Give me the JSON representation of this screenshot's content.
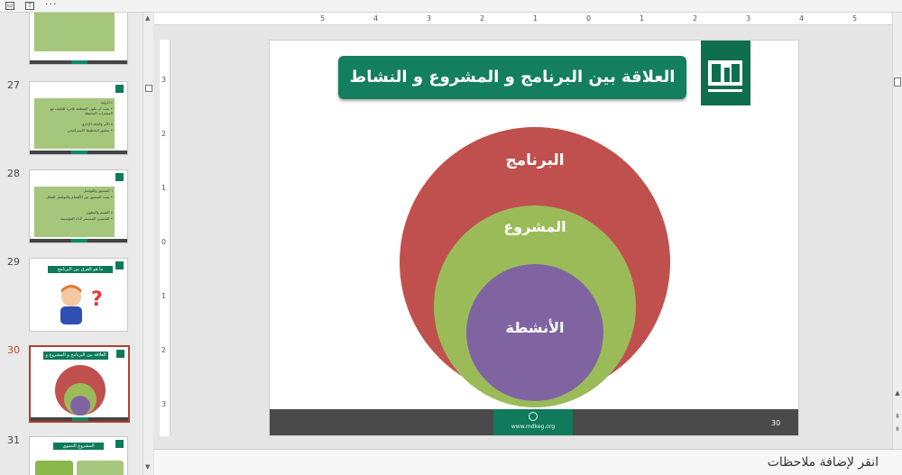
{
  "slides": [
    {
      "number": "27",
      "lines": [
        "٤ الرؤية",
        "• يجب أن تكون المنظمة قادرة للتكيف مع المتغيرات المحيطة",
        "٥ الأثر والعائد الإداري",
        "• تحقيق التخطيط الاستراتيجي"
      ]
    },
    {
      "number": "28",
      "lines": [
        "٦ التنسيق والتواصل",
        "• يجب التنسيق بين الأقسام والتواصل الفعال",
        "٧ التقييم والتطوير",
        "• التحسين المستمر لأداء المؤسسة"
      ]
    },
    {
      "number": "29",
      "title": "ما هو الفرق بين البرنامج والمشروع ؟"
    },
    {
      "number": "30",
      "title": "العلاقة بين البرنامج و المشروع و النشاط",
      "active": true
    },
    {
      "number": "31",
      "title": "المشروع التنموي"
    }
  ],
  "ruler": {
    "horizontal": [
      "5",
      "4",
      "3",
      "2",
      "1",
      "0",
      "1",
      "2",
      "3",
      "4",
      "5"
    ],
    "vertical": [
      "3",
      "2",
      "1",
      "0",
      "1",
      "2",
      "3"
    ]
  },
  "slide": {
    "title": "العلاقة بين البرنامج و المشروع و النشاط",
    "circles": {
      "outer": {
        "label": "البرنامج",
        "color": "#c0504d"
      },
      "middle": {
        "label": "المشروع",
        "color": "#9bbb59"
      },
      "inner": {
        "label": "الأنشطة",
        "color": "#8064a2"
      }
    },
    "footer_url": "www.mdkeg.org",
    "slide_number": "30"
  },
  "notes_placeholder": "انقر لإضافة ملاحظات",
  "colors": {
    "accent": "#147f5e",
    "active_border": "#b43f2f"
  }
}
